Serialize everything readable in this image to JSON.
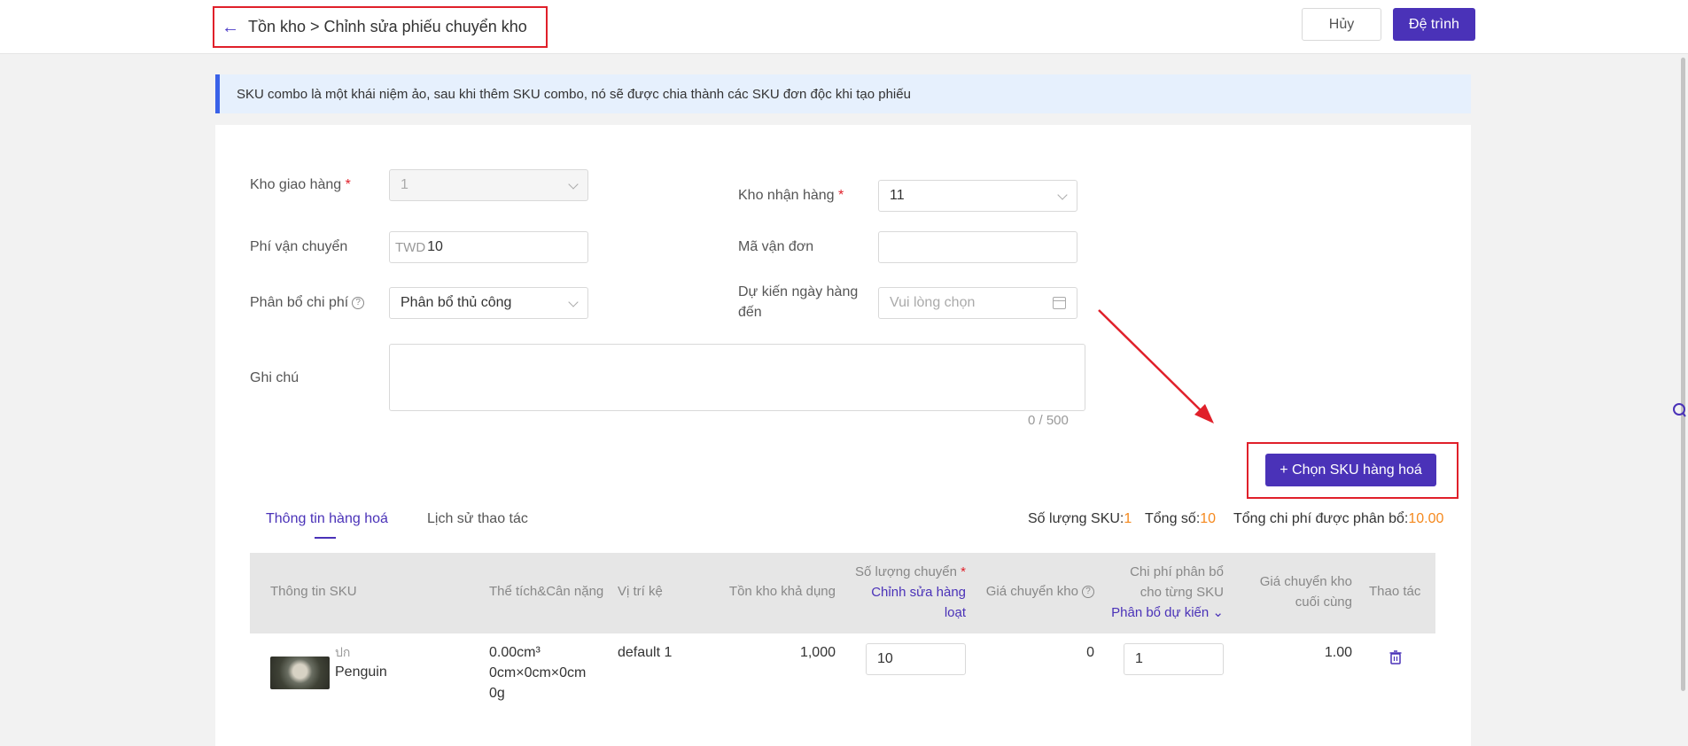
{
  "header": {
    "breadcrumb": "Tồn kho > Chỉnh sửa phiếu chuyển kho",
    "cancel_label": "Hủy",
    "submit_label": "Đệ trình"
  },
  "notice": "SKU combo là một khái niệm ảo, sau khi thêm SKU combo, nó sẽ được chia thành các SKU đơn độc khi tạo phiếu",
  "form": {
    "ship_warehouse_label": "Kho giao hàng",
    "ship_warehouse_value": "1",
    "receive_warehouse_label": "Kho nhận hàng",
    "receive_warehouse_value": "11",
    "shipping_fee_label": "Phí vận chuyển",
    "shipping_fee_currency": "TWD",
    "shipping_fee_value": "10",
    "tracking_label": "Mã vận đơn",
    "tracking_value": "",
    "cost_alloc_label": "Phân bổ chi phí",
    "cost_alloc_value": "Phân bổ thủ công",
    "eta_label_line1": "Dự kiến ngày hàng",
    "eta_label_line2": "đến",
    "eta_placeholder": "Vui lòng chọn",
    "note_label": "Ghi chú",
    "note_counter": "0 / 500",
    "required_mark": "*"
  },
  "sku_button_label": "+ Chọn SKU hàng hoá",
  "tabs": [
    {
      "label": "Thông tin hàng hoá",
      "active": true
    },
    {
      "label": "Lịch sử thao tác",
      "active": false
    }
  ],
  "stats": {
    "sku_count_label": "Số lượng SKU:",
    "sku_count_value": "1",
    "total_label": "Tổng số:",
    "total_value": "10",
    "alloc_label": "Tổng chi phí được phân bổ:",
    "alloc_value": "10.00"
  },
  "table": {
    "headers": {
      "sku_info": "Thông tin SKU",
      "volume_weight": "Thể tích&Cân nặng",
      "shelf": "Vị trí kệ",
      "available": "Tồn kho khả dụng",
      "transfer_qty": "Số lượng chuyển",
      "bulk_edit_line1": "Chỉnh sửa hàng",
      "bulk_edit_line2": "loạt",
      "transfer_price": "Giá chuyển kho",
      "alloc_cost_line1": "Chi phí phân bổ",
      "alloc_cost_line2": "cho từng SKU",
      "alloc_estimate": "Phân bổ dự kiến",
      "final_price_line1": "Giá chuyển kho",
      "final_price_line2": "cuối cùng",
      "actions": "Thao tác"
    },
    "rows": [
      {
        "sku_code": "ปก",
        "sku_name": "Penguin",
        "volume": "0.00cm³",
        "dimensions": "0cm×0cm×0cm",
        "weight": "0g",
        "shelf": "default 1",
        "available": "1,000",
        "transfer_qty": "10",
        "transfer_price": "0",
        "alloc_cost": "1",
        "final_price": "1.00"
      }
    ]
  },
  "colors": {
    "primary": "#4a32b8",
    "highlight_border": "#e0202a",
    "accent_orange": "#f5891e",
    "notice_bg": "#e6f0fd"
  }
}
